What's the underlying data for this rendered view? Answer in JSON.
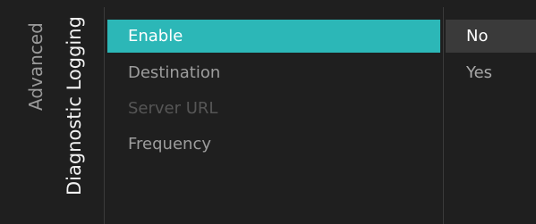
{
  "breadcrumb": {
    "parent": "Advanced",
    "current": "Diagnostic Logging"
  },
  "menu": {
    "items": [
      {
        "label": "Enable",
        "state": "selected"
      },
      {
        "label": "Destination",
        "state": "enabled"
      },
      {
        "label": "Server URL",
        "state": "disabled"
      },
      {
        "label": "Frequency",
        "state": "enabled"
      }
    ]
  },
  "options": {
    "items": [
      {
        "label": "No",
        "state": "current"
      },
      {
        "label": "Yes",
        "state": "available"
      }
    ]
  },
  "colors": {
    "background": "#1f1f1f",
    "accent": "#2cb7b7",
    "option_highlight": "#3a3a3a"
  }
}
